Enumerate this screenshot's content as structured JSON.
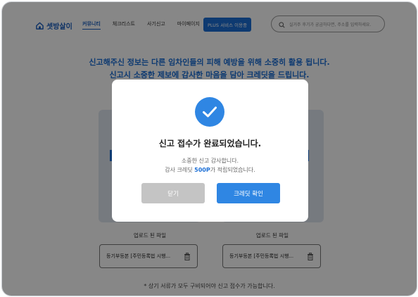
{
  "header": {
    "logo_text": "셋방살이",
    "nav": [
      "커뮤니티",
      "체크리스트",
      "사기신고",
      "마이페이지"
    ],
    "plus_button": "PLUS 서비스 이용중",
    "search_placeholder": "실거주 후기가 궁금하다면, 주소를 입력하세요."
  },
  "headline": {
    "line1": "신고해주신 정보는 다른 임차인들의 피해 예방을 위해 소중히 활용 됩니다.",
    "line2": "신고시 소중한 제보에 감사한 마음을 담아 크레딧을 드립니다."
  },
  "uploads": [
    {
      "label": "업로드 된 파일",
      "file": "등기부등본 [주민등록법 시행..."
    },
    {
      "label": "업로드 된 파일",
      "file": "등기부등본 [주민등록법 시행..."
    }
  ],
  "footnote": "* 상기 서류가 모두 구비되어야 신고 접수가 가능합니다.",
  "modal": {
    "title": "신고 접수가 완료되었습니다.",
    "message1": "소중한 신고 감사합니다.",
    "message2_prefix": "감사 크레딧 ",
    "points": "500P",
    "message2_suffix": "가 적립되었습니다.",
    "close_button": "닫기",
    "credit_button": "크레딧 확인"
  },
  "colors": {
    "brand": "#1c6fd6",
    "check": "#2f86e3",
    "disabled_button": "#c4c4c4"
  }
}
